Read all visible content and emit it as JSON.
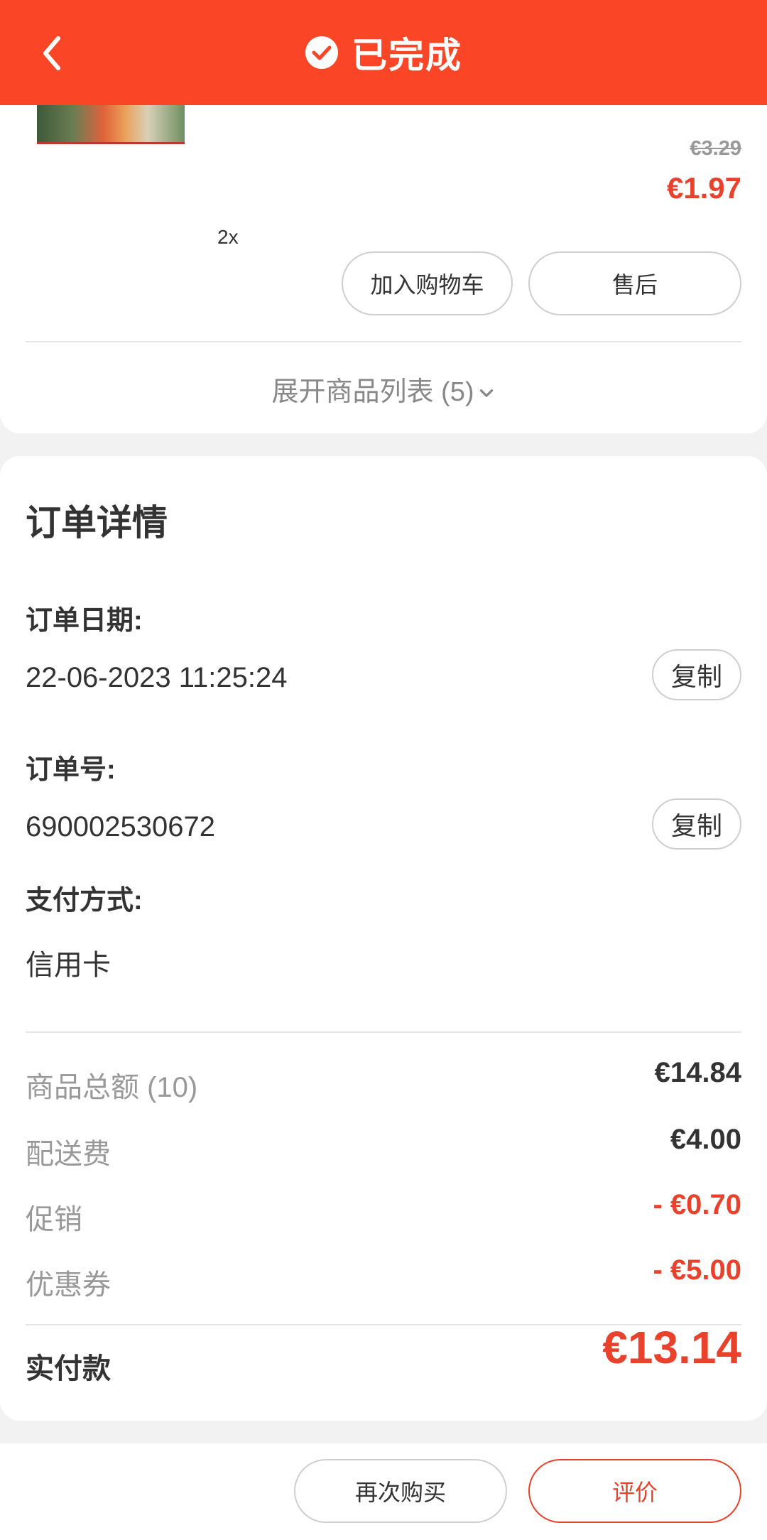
{
  "header": {
    "title": "已完成",
    "color": "#fa4527"
  },
  "product": {
    "old_price": "€3.29",
    "price": "€1.97",
    "quantity": "2x",
    "add_to_cart_label": "加入购物车",
    "after_sales_label": "售后"
  },
  "expand_list_label": "展开商品列表 (5)",
  "details": {
    "title": "订单详情",
    "date_label": "订单日期:",
    "date_value": "22-06-2023 11:25:24",
    "order_no_label": "订单号:",
    "order_no_value": "690002530672",
    "copy_label": "复制",
    "payment_label": "支付方式:",
    "payment_value": "信用卡"
  },
  "summary": {
    "subtotal_label": "商品总额 (10)",
    "subtotal_value": "€14.84",
    "delivery_label": "配送费",
    "delivery_value": "€4.00",
    "promotion_label": "促销",
    "promotion_value": "- €0.70",
    "coupon_label": "优惠券",
    "coupon_value": "- €5.00",
    "total_label": "实付款",
    "total_value": "€13.14"
  },
  "bottom": {
    "rebuy_label": "再次购买",
    "review_label": "评价"
  },
  "icons": {
    "back": "back-arrow-icon",
    "check": "check-circle-icon",
    "expand": "chevron-down-icon"
  }
}
